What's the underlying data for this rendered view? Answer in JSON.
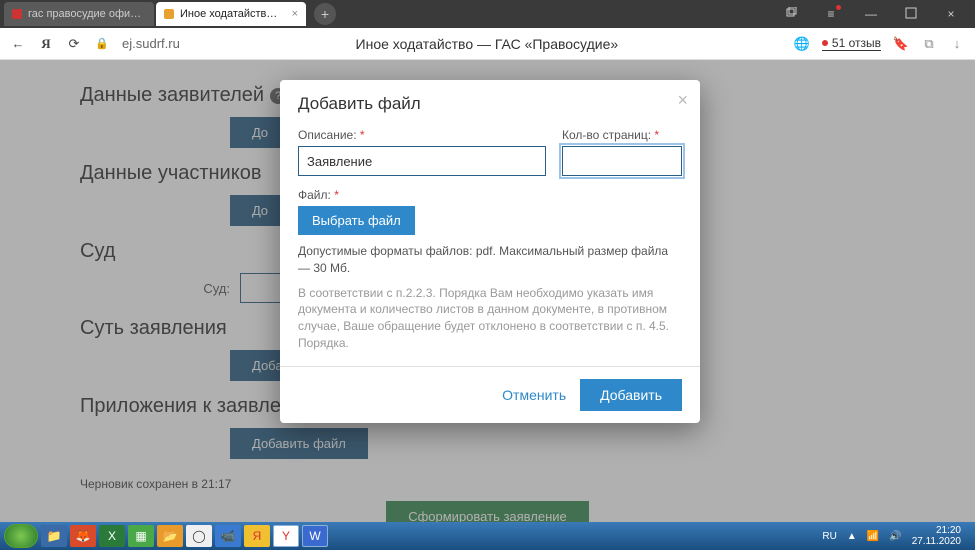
{
  "browser": {
    "tabs": [
      {
        "label": "гас правосудие официаль",
        "active": false
      },
      {
        "label": "Иное ходатайство — Г…",
        "active": true
      }
    ],
    "url_host": "ej.sudrf.ru",
    "page_title": "Иное ходатайство — ГАС «Правосудие»",
    "reviews": "51 отзыв"
  },
  "page": {
    "sec_applicants": "Данные заявителей",
    "sec_participants": "Данные участников",
    "sec_court": "Суд",
    "court_label": "Суд:",
    "sec_subject": "Суть заявления",
    "sec_attachments": "Приложения к заявлению",
    "btn_add": "Дo",
    "btn_add_file": "Добавить файл",
    "draft_saved": "Черновик сохранен в 21:17",
    "btn_submit_form": "Сформировать заявление"
  },
  "modal": {
    "title": "Добавить файл",
    "desc_label": "Описание:",
    "desc_value": "Заявление",
    "pages_label": "Кол-во страниц:",
    "pages_value": "",
    "file_label": "Файл:",
    "choose_file": "Выбрать файл",
    "hint_formats": "Допустимые форматы файлов: pdf. Максимальный размер файла — 30 Мб.",
    "hint_rules": "В соответствии с п.2.2.3. Порядка Вам необходимо указать имя документа и количество листов в данном документе, в противном случае, Ваше обращение будет отклонено в соответствии с п. 4.5. Порядка.",
    "cancel": "Отменить",
    "add": "Добавить"
  },
  "taskbar": {
    "lang": "RU",
    "time": "21:20",
    "date": "27.11.2020"
  }
}
